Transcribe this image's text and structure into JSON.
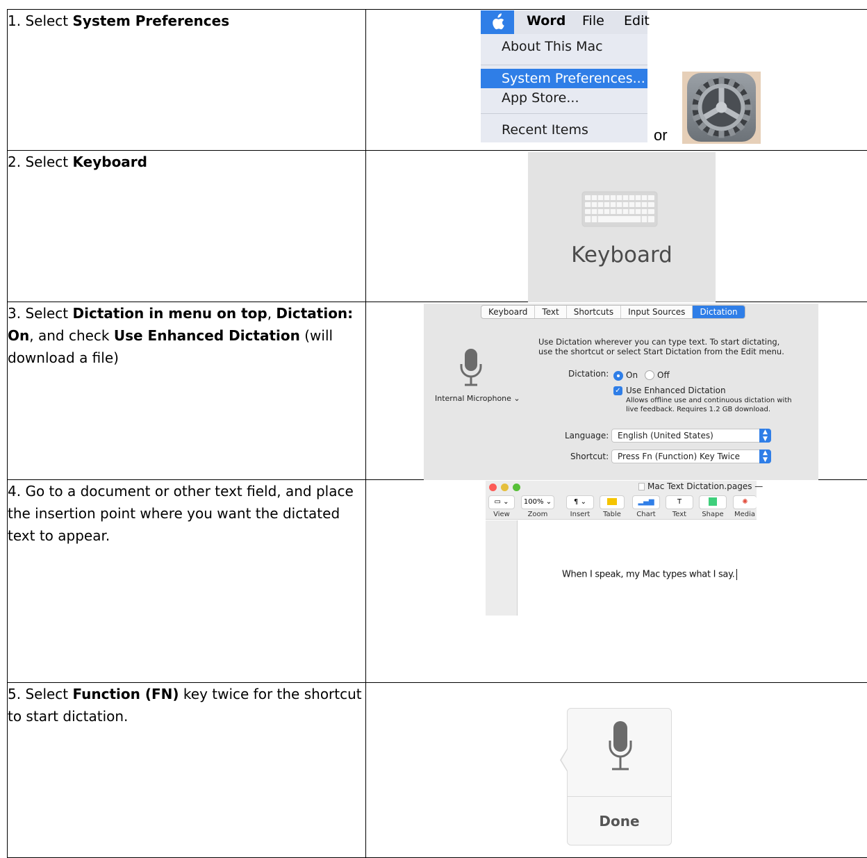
{
  "steps": [
    {
      "text_pre": "1. Select ",
      "bold": "System Preferences",
      "text_post": ""
    },
    {
      "text_pre": "2. Select ",
      "bold": "Keyboard",
      "text_post": ""
    },
    {
      "text_a": "3. Select ",
      "bold_a": "Dictation in menu on top",
      "text_b": ", ",
      "bold_b": "Dictation: On",
      "text_c": ", and check ",
      "bold_c": "Use Enhanced Dictation",
      "text_d": " (will download a file)"
    },
    {
      "text": "4.  Go to a document or other text field, and place the insertion point where you want the dictated text to appear."
    },
    {
      "text_pre": "5. Select ",
      "bold": "Function (FN)",
      "text_post": "  key twice for the shortcut to start dictation."
    }
  ],
  "menu": {
    "apple_icon": "apple-icon",
    "bar": [
      "Word",
      "File",
      "Edit"
    ],
    "items": [
      "About This Mac",
      "System Preferences...",
      "App Store...",
      "Recent Items"
    ]
  },
  "or_label": "or",
  "keyboard_pane": {
    "label": "Keyboard",
    "icon": "keyboard-icon"
  },
  "dictation_prefs": {
    "tabs": [
      "Keyboard",
      "Text",
      "Shortcuts",
      "Input Sources",
      "Dictation"
    ],
    "active_tab": "Dictation",
    "intro_line1": "Use Dictation wherever you can type text. To start dictating,",
    "intro_line2": "use the shortcut or select Start Dictation from the Edit menu.",
    "mic_label": "Internal Microphone",
    "dictation_label": "Dictation:",
    "on_label": "On",
    "off_label": "Off",
    "enhanced_label": "Use Enhanced Dictation",
    "enhanced_desc1": "Allows offline use and continuous dictation with",
    "enhanced_desc2": "live feedback. Requires 1.2 GB download.",
    "language_label": "Language:",
    "language_value": "English (United States)",
    "shortcut_label": "Shortcut:",
    "shortcut_value": "Press Fn (Function) Key Twice"
  },
  "pages": {
    "title": "Mac Text Dictation.pages —",
    "zoom": "100%",
    "toolbar_labels": [
      "View",
      "Zoom",
      "Insert",
      "Table",
      "Chart",
      "Text",
      "Shape",
      "Media"
    ],
    "doc_text": "When I speak, my Mac types what I say."
  },
  "dictation_popup": {
    "done_label": "Done"
  },
  "colors": {
    "accent": "#2f7ee7",
    "menu_bg": "#e7eaf2",
    "pane_bg": "#e3e3e3"
  }
}
